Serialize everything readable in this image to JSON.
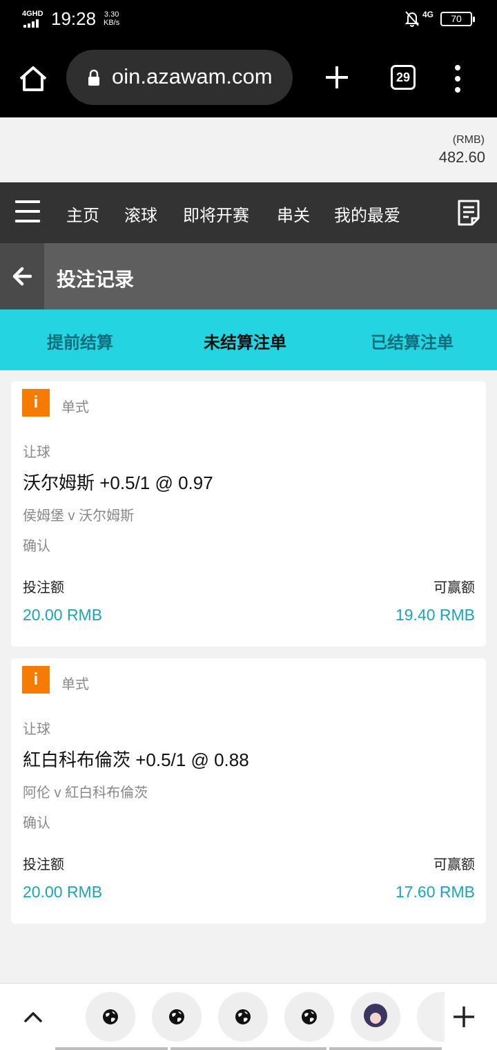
{
  "status_bar": {
    "network": "4GHD",
    "time": "19:28",
    "speed_value": "3.30",
    "speed_unit": "KB/s",
    "mobile": "4G",
    "battery": "70"
  },
  "browser": {
    "url": "oin.azawam.com",
    "tab_count": "29"
  },
  "balance": {
    "currency": "(RMB)",
    "amount": "482.60"
  },
  "nav": {
    "items": [
      "主页",
      "滚球",
      "即将开赛",
      "串关",
      "我的最爱"
    ]
  },
  "header": {
    "title": "投注记录"
  },
  "tabs": [
    {
      "label": "提前结算",
      "active": false
    },
    {
      "label": "未结算注单",
      "active": true
    },
    {
      "label": "已结算注单",
      "active": false
    }
  ],
  "bets": [
    {
      "badge": "i",
      "bet_type": "单式",
      "market": "让球",
      "selection": "沃尔姆斯 +0.5/1 @ 0.97",
      "match": "侯姆堡 v 沃尔姆斯",
      "status": "确认",
      "stake_label": "投注额",
      "win_label": "可赢额",
      "stake": "20.00 RMB",
      "to_win": "19.40 RMB"
    },
    {
      "badge": "i",
      "bet_type": "单式",
      "market": "让球",
      "selection": "紅白科布倫茨 +0.5/1 @ 0.88",
      "match": "阿伦 v 紅白科布倫茨",
      "status": "确认",
      "stake_label": "投注额",
      "win_label": "可赢额",
      "stake": "20.00 RMB",
      "to_win": "17.60 RMB"
    }
  ],
  "colors": {
    "tab_bar": "#24d5e1",
    "amount": "#1aa6b3",
    "badge": "#f57c00",
    "nav": "#333333"
  }
}
